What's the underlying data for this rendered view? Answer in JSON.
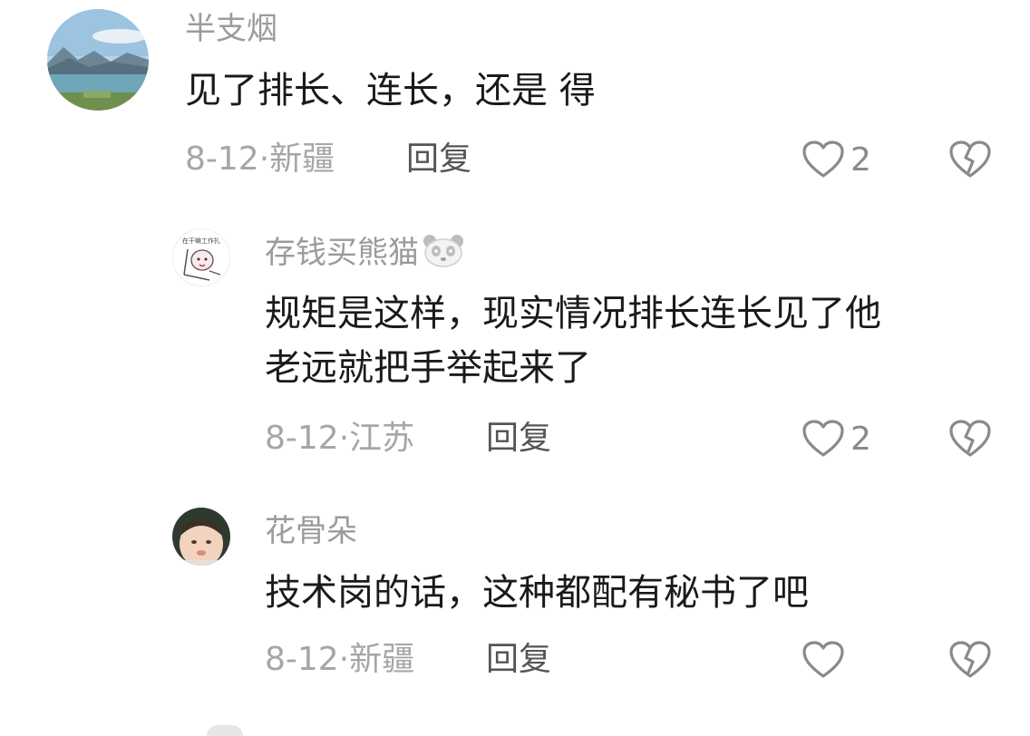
{
  "comments": [
    {
      "username": "半支烟",
      "text_lines": [
        "见了排长、连长，还是  得"
      ],
      "date_location": "8-12·新疆",
      "reply_label": "回复",
      "likes": "2",
      "avatar": "lake-landscape-avatar"
    },
    {
      "username": "存钱买熊猫",
      "username_emoji": "panda-icon",
      "text_lines": [
        "规矩是这样，现实情况排长连长见了他",
        "老远就把手举起来了"
      ],
      "date_location": "8-12·江苏",
      "reply_label": "回复",
      "likes": "2",
      "avatar": "cartoon-sketch-avatar",
      "avatar_text": "在干嘛工作扎"
    },
    {
      "username": "花骨朵",
      "text_lines": [
        "技术岗的话，这种都配有秘书了吧"
      ],
      "date_location": "8-12·新疆",
      "reply_label": "回复",
      "likes": "",
      "avatar": "baby-photo-avatar"
    }
  ],
  "colors": {
    "username": "#9b9b9b",
    "text": "#1a1a1a",
    "meta": "#a6a6a6",
    "reply": "#555555",
    "icon": "#8a8a8a"
  }
}
